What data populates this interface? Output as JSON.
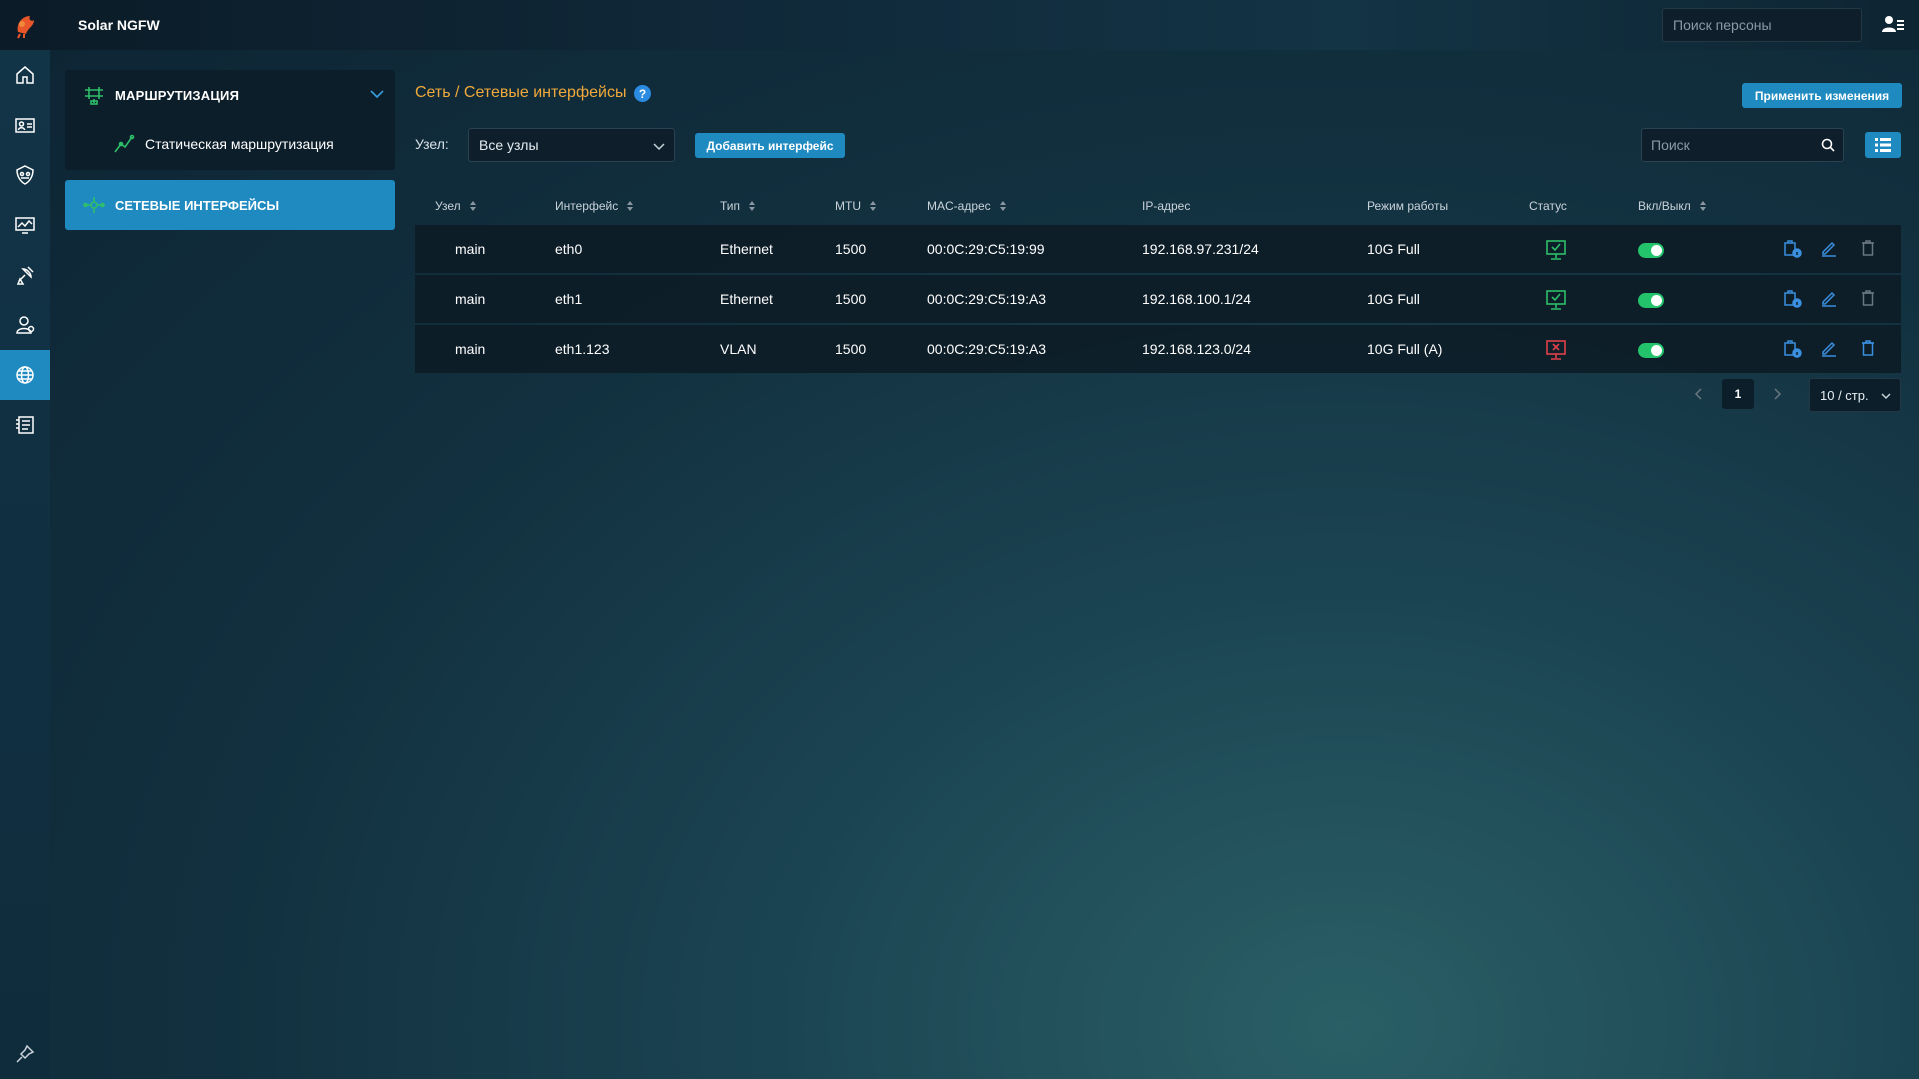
{
  "app": {
    "title": "Solar NGFW"
  },
  "topbar": {
    "person_search_placeholder": "Поиск персоны"
  },
  "rail": {
    "icons": [
      "home-icon",
      "id-card-icon",
      "shield-icon",
      "monitoring-icon",
      "satellite-icon",
      "user-icon",
      "network-icon",
      "log-icon",
      "pin-icon"
    ],
    "active_index": 6
  },
  "sidebar": {
    "group": {
      "label": "МАРШРУТИЗАЦИЯ",
      "expanded": true
    },
    "sub_item": {
      "label": "Статическая маршрутизация"
    },
    "active_item": {
      "label": "СЕТЕВЫЕ ИНТЕРФЕЙСЫ"
    }
  },
  "main": {
    "breadcrumb": "Сеть / Сетевые интерфейсы",
    "help": "?",
    "apply_label": "Применить изменения",
    "node_label": "Узел:",
    "node_value": "Все узлы",
    "add_label": "Добавить интерфейс",
    "search_placeholder": "Поиск"
  },
  "table": {
    "columns": [
      "Узел",
      "Интерфейс",
      "Тип",
      "MTU",
      "MAC-адрес",
      "IP-адрес",
      "Режим работы",
      "Статус",
      "Вкл/Выкл"
    ],
    "rows": [
      {
        "node": "main",
        "iface": "eth0",
        "type": "Ethernet",
        "mtu": "1500",
        "mac": "00:0C:29:C5:19:99",
        "ip": "192.168.97.231/24",
        "mode": "10G Full",
        "status": "up",
        "enabled": true
      },
      {
        "node": "main",
        "iface": "eth1",
        "type": "Ethernet",
        "mtu": "1500",
        "mac": "00:0C:29:C5:19:A3",
        "ip": "192.168.100.1/24",
        "mode": "10G Full",
        "status": "up",
        "enabled": true
      },
      {
        "node": "main",
        "iface": "eth1.123",
        "type": "VLAN",
        "mtu": "1500",
        "mac": "00:0C:29:C5:19:A3",
        "ip": "192.168.123.0/24",
        "mode": "10G Full (A)",
        "status": "down",
        "enabled": true
      }
    ]
  },
  "pagination": {
    "current_page": "1",
    "page_size": "10 / стр."
  },
  "colors": {
    "accent": "#1f8ac0",
    "breadcrumb": "#f0a93a",
    "status_up": "#2fbf6a",
    "status_down": "#e0404a",
    "toggle_on": "#22c36b",
    "action_icon": "#3a8fe0"
  }
}
